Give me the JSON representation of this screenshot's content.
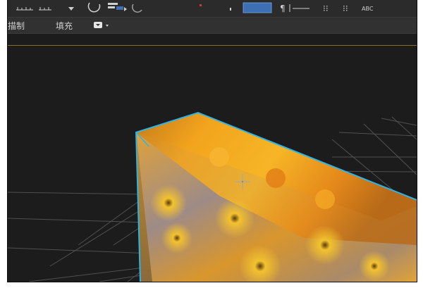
{
  "options_bar": {
    "stroke_label": "描制",
    "fill_label": "填充"
  },
  "toolbar": {
    "text_tool_label": "ABC"
  },
  "icons": [
    "ruler-icon",
    "dropdown-arrow-icon",
    "circle-icon",
    "align-icon",
    "color-rect-icon",
    "text-path-icon",
    "pin-icon",
    "text-tool-icon",
    "fill-swatch-icon"
  ],
  "colors": {
    "viewport_bg": "#1c1c1c",
    "grid_line": "#555555",
    "selection_outline": "#2fb4e6",
    "accent_button": "#3d6fb5",
    "gold_rule": "#8c6f22"
  }
}
